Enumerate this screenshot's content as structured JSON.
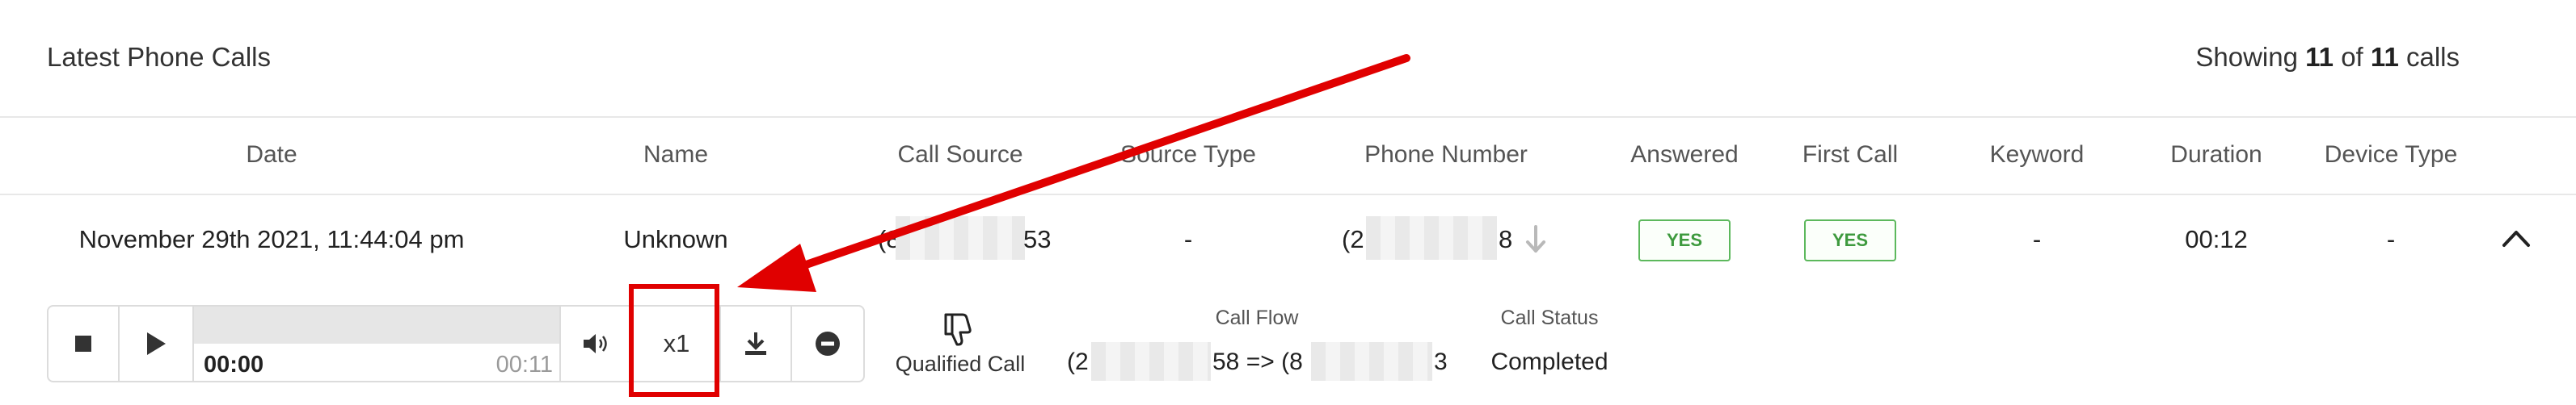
{
  "header": {
    "title": "Latest Phone Calls",
    "showing_prefix": "Showing",
    "showing_count": "11",
    "showing_of": "of",
    "showing_total": "11",
    "showing_suffix": "calls"
  },
  "columns": [
    "Date",
    "Name",
    "Call Source",
    "Source Type",
    "Phone Number",
    "Answered",
    "First Call",
    "Keyword",
    "Duration",
    "Device Type"
  ],
  "row": {
    "date": "November 29th 2021, 11:44:04 pm",
    "name": "Unknown",
    "call_source_start": "(8",
    "call_source_end": "53",
    "source_type": "-",
    "phone_start": "(2",
    "phone_end": "8",
    "answered": "YES",
    "first_call": "YES",
    "keyword": "-",
    "duration": "00:12",
    "device_type": "-"
  },
  "player": {
    "current_time": "00:00",
    "total_time": "00:11",
    "speed": "x1",
    "progress_fraction": 0.0
  },
  "details": {
    "qualified_label": "Qualified Call",
    "call_flow_label": "Call Flow",
    "call_flow_start": "(2",
    "call_flow_mid": "58 => (8",
    "call_flow_end": "3",
    "call_status_label": "Call Status",
    "call_status": "Completed"
  },
  "colors": {
    "badge_green": "#5cb85c",
    "annotation_red": "#e00000"
  }
}
